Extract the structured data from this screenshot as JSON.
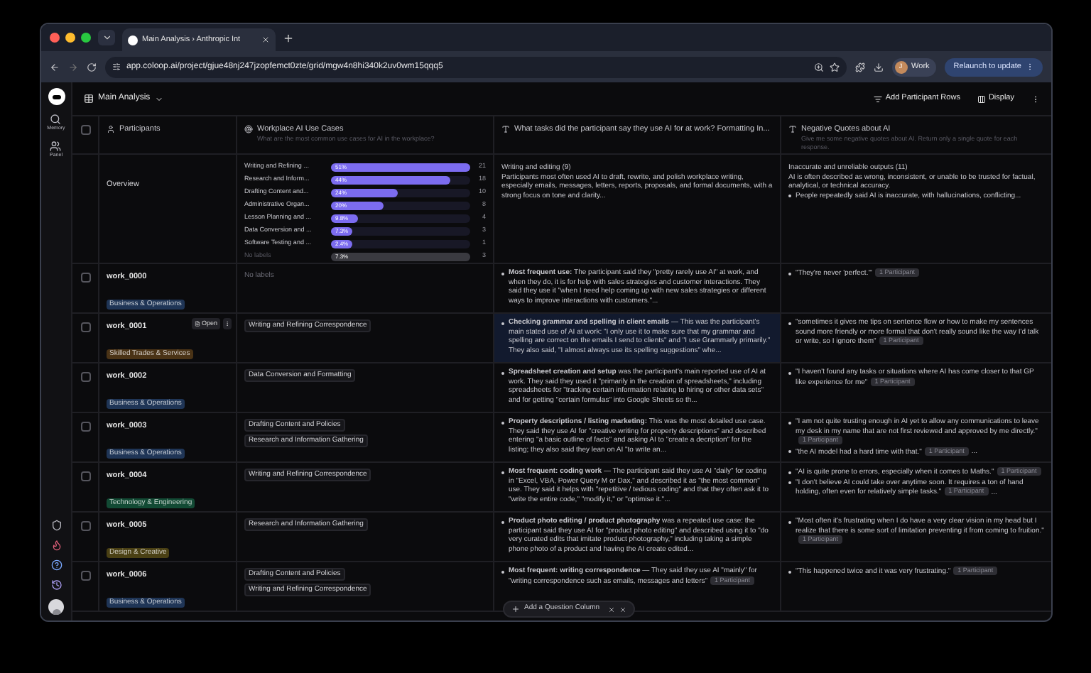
{
  "browser": {
    "tab_title": "Main Analysis › Anthropic Int",
    "url": "app.coloop.ai/project/gjue48nj247jzopfemct0zte/grid/mgw4n8hi340k2uv0wm15qqq5",
    "profile": {
      "initial": "J",
      "label": "Work"
    },
    "relaunch": "Relaunch to update"
  },
  "sidebar": {
    "items": [
      {
        "label": "Memory",
        "kind": "search"
      },
      {
        "label": "Panel",
        "kind": "users"
      }
    ]
  },
  "toolbar": {
    "view": "Main Analysis",
    "actions": [
      {
        "label": "Add Participant Rows",
        "kind": "filter"
      },
      {
        "label": "Display",
        "kind": "columns"
      }
    ]
  },
  "header_checked": false,
  "columns": [
    {
      "title": "Participants",
      "kind": "person"
    },
    {
      "title": "Workplace AI Use Cases",
      "subtitle": "What are the most common use cases for AI in the workplace?",
      "kind": "target"
    },
    {
      "title": "What tasks did the participant say they use AI for at work? Formatting In...",
      "kind": "text"
    },
    {
      "title": "Negative Quotes about AI",
      "subtitle": "Give me some negative quotes about AI. Return only a single quote for each response.",
      "kind": "text"
    }
  ],
  "overview": {
    "label": "Overview",
    "use_cases": [
      {
        "label": "Writing and Refining ...",
        "percent": "51%",
        "count": "21",
        "level": 1,
        "muted": false
      },
      {
        "label": "Research and Inform...",
        "percent": "44%",
        "count": "18",
        "level": 0.86,
        "muted": false
      },
      {
        "label": "Drafting Content and...",
        "percent": "24%",
        "count": "10",
        "level": 0.48,
        "muted": false
      },
      {
        "label": "Administrative Organ...",
        "percent": "20%",
        "count": "8",
        "level": 0.38,
        "muted": false
      },
      {
        "label": "Lesson Planning and ...",
        "percent": "9.8%",
        "count": "4",
        "level": 0.19,
        "muted": false
      },
      {
        "label": "Data Conversion and ...",
        "percent": "7.3%",
        "count": "3",
        "level": 0.15,
        "muted": false
      },
      {
        "label": "Software Testing and ...",
        "percent": "2.4%",
        "count": "1",
        "level": 0.15,
        "muted": false
      },
      {
        "label": "No labels",
        "percent": "7.3%",
        "count": "3",
        "level": 1,
        "muted": true
      }
    ],
    "tasks": {
      "title": "Writing and editing (9)",
      "text": "Participants most often used AI to draft, rewrite, and polish workplace writing, especially emails, messages, letters, reports, proposals, and formal documents, with a strong focus on tone and clarity..."
    },
    "negative": {
      "title": "Inaccurate and unreliable outputs (11)",
      "text": "AI is often described as wrong, inconsistent, or unable to be trusted for factual, analytical, or technical accuracy.",
      "bullets": [
        "People repeatedly said AI is inaccurate, with hallucinations, conflicting..."
      ]
    }
  },
  "rows": [
    {
      "id": "work_0000",
      "checked": false,
      "highlighted": false,
      "category": {
        "label": "Business & Operations",
        "color": "#1f3556"
      },
      "use_cases_placeholder": "No labels",
      "use_cases": [],
      "tasks": [
        {
          "text": "**Most frequent use:** The participant said they \"pretty rarely use AI\" at work, and when they do, it is for help with sales strategies and customer interactions. They said they use it \"when I need help coming up with new sales strategies or different ways to improve interactions with customers.\"..."
        }
      ],
      "quotes": [
        {
          "text": "\"They're never 'perfect.'\"",
          "badge": "1 Participant"
        }
      ]
    },
    {
      "id": "work_0001",
      "checked": false,
      "highlighted": true,
      "open_label": "Open",
      "category": {
        "label": "Skilled Trades & Services",
        "color": "#4a3316"
      },
      "use_cases": [
        "Writing and Refining Correspondence"
      ],
      "tasks": [
        {
          "text": "**Checking grammar and spelling in client emails** — This was the participant's main stated use of AI at work: \"I only use it to make sure that my grammar and spelling are correct on the emails I send to clients\" and \"I use Grammarly primarily.\" They also said, \"I almost always use its spelling suggestions\" whe..."
        }
      ],
      "quotes": [
        {
          "text": "\"sometimes it gives me tips on sentence flow or how to make my sentences sound more friendly or more formal that don't really sound like the way I'd talk or write, so I ignore them\"",
          "badge": "1 Participant"
        }
      ]
    },
    {
      "id": "work_0002",
      "checked": false,
      "highlighted": false,
      "category": {
        "label": "Business & Operations",
        "color": "#1f3556"
      },
      "use_cases": [
        "Data Conversion and Formatting"
      ],
      "tasks": [
        {
          "text": "**Spreadsheet creation and setup** was the participant's main reported use of AI at work. They said they used it \"primarily in the creation of spreadsheets,\" including spreadsheets for \"tracking certain information relating to hiring or other data sets\" and for getting \"certain formulas\" into Google Sheets so th..."
        }
      ],
      "quotes": [
        {
          "text": "\"I haven't found any tasks or situations where AI has come closer to that GP like experience for me\"",
          "badge": "1 Participant"
        }
      ]
    },
    {
      "id": "work_0003",
      "checked": false,
      "highlighted": false,
      "category": {
        "label": "Business & Operations",
        "color": "#1f3556"
      },
      "use_cases": [
        "Drafting Content and Policies",
        "Research and Information Gathering"
      ],
      "tasks": [
        {
          "text": "**Property descriptions / listing marketing:** This was the most detailed use case. They said they use AI for \"creative writing for property descriptions\" and described entering \"a basic outline of facts\" and asking AI to \"create a decription\" for the listing; they also said they lean on AI \"to write an..."
        }
      ],
      "quotes": [
        {
          "text": "\"I am not quite trusting enough in AI yet to allow any communications to leave my desk in my name that are not first reviewed and approved by me directly.\"",
          "badge": "1 Participant"
        },
        {
          "text": "\"the AI model had a hard time with that.\"",
          "badge": "1 Participant",
          "trail": "..."
        }
      ]
    },
    {
      "id": "work_0004",
      "checked": false,
      "highlighted": false,
      "category": {
        "label": "Technology & Engineering",
        "color": "#124a34"
      },
      "use_cases": [
        "Writing and Refining Correspondence"
      ],
      "tasks": [
        {
          "text": "**Most frequent: coding work** — The participant said they use AI \"daily\" for coding in \"Excel, VBA, Power Query M or Dax,\" and described it as \"the most common\" use. They said it helps with \"repetitive / tedious coding\" and that they often ask it to \"write the entire code,\" \"modify it,\" or \"optimise it.\"..."
        }
      ],
      "quotes": [
        {
          "text": "\"AI is quite prone to errors, especially when it comes to Maths.\"",
          "badge": "1 Participant"
        },
        {
          "text": "\"I don't believe AI could take over anytime soon. It requires a ton of hand holding, often even for relatively simple tasks.\"",
          "badge": "1 Participant",
          "trail": "..."
        }
      ]
    },
    {
      "id": "work_0005",
      "checked": false,
      "highlighted": false,
      "category": {
        "label": "Design & Creative",
        "color": "#4a4014"
      },
      "use_cases": [
        "Research and Information Gathering"
      ],
      "tasks": [
        {
          "text": "**Product photo editing / product photography** was a repeated use case: the participant said they use AI for \"product photo editing\" and described using it to \"do very curated edits that imitate product photography,\" including taking a simple phone photo of a product and having the AI create edited..."
        }
      ],
      "quotes": [
        {
          "text": "\"Most often it's frustrating when I do have a very clear vision in my head but I realize that there is some sort of limitation preventing it from coming to fruition.\"",
          "badge": "1 Participant"
        }
      ]
    },
    {
      "id": "work_0006",
      "checked": false,
      "highlighted": false,
      "category": {
        "label": "Business & Operations",
        "color": "#1f3556"
      },
      "use_cases": [
        "Drafting Content and Policies",
        "Writing and Refining Correspondence"
      ],
      "tasks": [
        {
          "text": "**Most frequent: writing correspondence** — They said they use AI \"mainly\" for \"writing correspondence such as emails, messages and letters\"",
          "badge": "1 Participant"
        }
      ],
      "quotes": [
        {
          "text": "\"This happened twice and it was very frustrating.\"",
          "badge": "1 Participant"
        }
      ]
    }
  ],
  "floating_button": {
    "label": "Add a Question Column"
  }
}
